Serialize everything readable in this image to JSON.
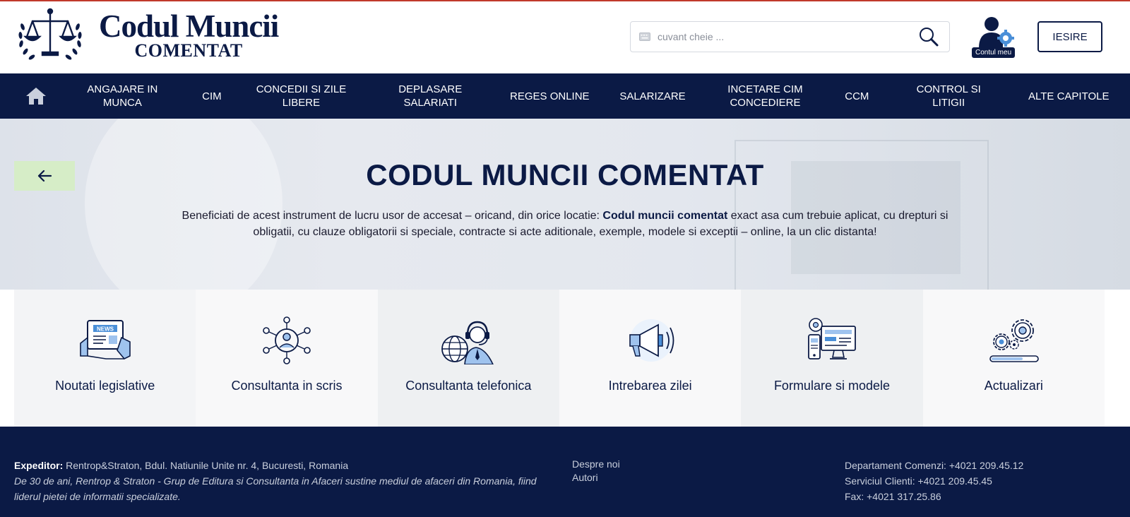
{
  "header": {
    "logo_title": "Codul Muncii",
    "logo_subtitle": "COMENTAT",
    "search_placeholder": "cuvant cheie ...",
    "account_label": "Contul meu",
    "logout_label": "IESIRE"
  },
  "nav": {
    "home_icon": "home-icon",
    "items": [
      {
        "label": "ANGAJARE IN MUNCA"
      },
      {
        "label": "CIM"
      },
      {
        "label": "CONCEDII SI ZILE LIBERE"
      },
      {
        "label": "DEPLASARE SALARIATI"
      },
      {
        "label": "REGES ONLINE"
      },
      {
        "label": "SALARIZARE"
      },
      {
        "label": "INCETARE CIM CONCEDIERE"
      },
      {
        "label": "CCM"
      },
      {
        "label": "CONTROL SI LITIGII"
      },
      {
        "label": "ALTE CAPITOLE"
      }
    ]
  },
  "hero": {
    "title": "CODUL MUNCII COMENTAT",
    "text_before": "Beneficiati de acest instrument de lucru usor de accesat – oricand, din orice locatie: ",
    "text_bold": "Codul muncii comentat",
    "text_after": " exact asa cum trebuie aplicat, cu drepturi si obligatii, cu clauze obligatorii si speciale, contracte si acte aditionale, exemple, modele si exceptii – online, la un clic distanta!"
  },
  "tiles": [
    {
      "label": "Noutati legislative",
      "icon": "news-icon"
    },
    {
      "label": "Consultanta in scris",
      "icon": "network-people-icon"
    },
    {
      "label": "Consultanta telefonica",
      "icon": "headset-globe-icon"
    },
    {
      "label": "Intrebarea zilei",
      "icon": "megaphone-icon"
    },
    {
      "label": "Formulare si modele",
      "icon": "devices-forms-icon"
    },
    {
      "label": "Actualizari",
      "icon": "gears-update-icon"
    }
  ],
  "footer": {
    "expeditor_label": "Expeditor:",
    "expeditor_text": " Rentrop&Straton, Bdul. Natiunile Unite nr. 4, Bucuresti, Romania",
    "about": "De 30 de ani, Rentrop & Straton - Grup de Editura si Consultanta in Afaceri sustine mediul de afaceri din Romania, fiind liderul pietei de informatii specializate.",
    "links": [
      "Despre noi",
      "Autori"
    ],
    "contacts": [
      "Departament Comenzi: +4021 209.45.12",
      "Serviciul Clienti: +4021 209.45.45",
      "Fax: +4021 317.25.86"
    ]
  },
  "colors": {
    "navy": "#0b1a45",
    "accent_blue": "#4a8fd8",
    "back_button": "#d6edc7"
  }
}
